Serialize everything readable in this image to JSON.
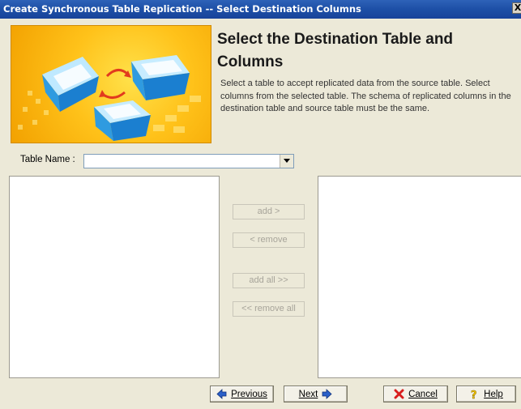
{
  "window": {
    "title": "Create Synchronous Table Replication -- Select Destination Columns",
    "close_label": "X"
  },
  "header": {
    "title": "Select the Destination Table and Columns",
    "description": "Select a table to accept replicated data from the source table. Select columns from the selected table. The schema of replicated columns in the destination table and source table must be the same."
  },
  "table_name": {
    "label": "Table Name :",
    "selected_value": ""
  },
  "source_columns": [],
  "destination_columns": [],
  "move_buttons": {
    "add": "add >",
    "remove": "< remove",
    "add_all": "add all >>",
    "remove_all": "<< remove all",
    "enabled": false
  },
  "footer": {
    "previous": "Previous",
    "next": "Next",
    "cancel": "Cancel",
    "help": "Help"
  },
  "icons": {
    "banner": "database-replication-icon",
    "previous": "arrow-left-icon",
    "next": "arrow-right-icon",
    "cancel": "red-x-icon",
    "help": "question-mark-icon"
  },
  "colors": {
    "titlebar": "#1d4fa6",
    "dialog_bg": "#ece9d8",
    "banner": "#ffc21a",
    "nav_arrow": "#2a5fc8",
    "cancel_x": "#d81e1e",
    "help_question": "#f2c300"
  }
}
